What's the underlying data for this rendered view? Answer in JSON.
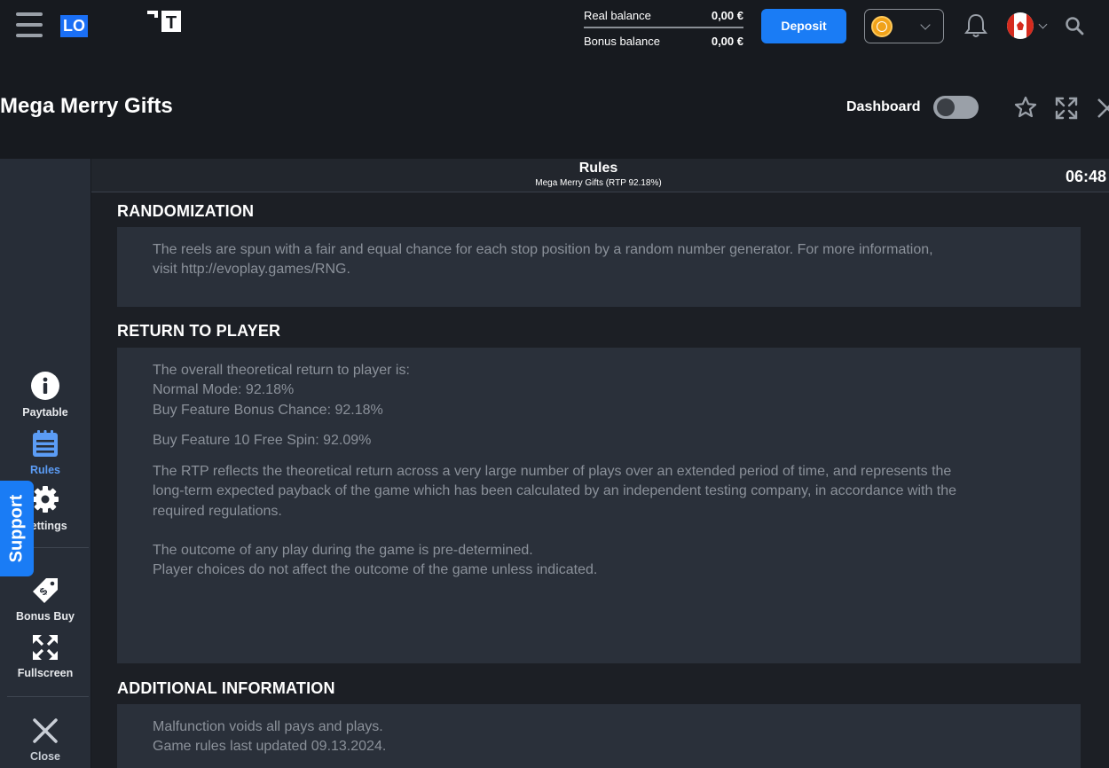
{
  "header": {
    "logo_text": "LO",
    "logo_mark": "T",
    "real_balance_label": "Real balance",
    "real_balance_value": "0,00 €",
    "bonus_balance_label": "Bonus balance",
    "bonus_balance_value": "0,00 €",
    "deposit_label": "Deposit"
  },
  "game": {
    "title": "Mega Merry Gifts",
    "dashboard_label": "Dashboard"
  },
  "sidebar": {
    "items": [
      {
        "label": "Paytable",
        "icon": "info-icon"
      },
      {
        "label": "Rules",
        "icon": "rules-icon"
      },
      {
        "label": "Settings",
        "icon": "gear-icon"
      },
      {
        "label": "Bonus Buy",
        "icon": "price-tag-icon"
      },
      {
        "label": "Fullscreen",
        "icon": "fullscreen-icon"
      },
      {
        "label": "Close",
        "icon": "close-icon"
      }
    ],
    "support_label": "Support"
  },
  "rules": {
    "title": "Rules",
    "subtitle": "Mega Merry Gifts (RTP 92.18%)",
    "time": "06:48",
    "sections": {
      "randomization": {
        "title": "RANDOMIZATION",
        "line1": "The reels are spun with a fair and equal chance for each stop position by a random number generator. For more information,",
        "line2": "visit http://evoplay.games/RNG."
      },
      "rtp": {
        "title": "RETURN TO PLAYER",
        "line1": "The overall theoretical return to player is:",
        "line2": "Normal Mode: 92.18%",
        "line3": "Buy Feature Bonus Chance: 92.18%",
        "line4": "Buy Feature 10 Free Spin: 92.09%",
        "line5": "The RTP reflects the theoretical return across a very large number of plays over an extended period of time, and represents the",
        "line6": "long-term expected payback of the game which has been calculated by an independent testing company, in accordance with the",
        "line7": "required regulations.",
        "line8": "The outcome of any play during the game is pre-determined.",
        "line9": "Player choices do not affect the outcome of the game unless indicated."
      },
      "additional": {
        "title": "ADDITIONAL INFORMATION",
        "line1": "Malfunction voids all pays and plays.",
        "line2": "Game rules last updated 09.13.2024."
      }
    }
  },
  "colors": {
    "accent": "#1a7cf5",
    "background": "#171a1f",
    "sidebar": "#272d37",
    "section_box": "#2a303a",
    "body_text": "#8b919a"
  }
}
